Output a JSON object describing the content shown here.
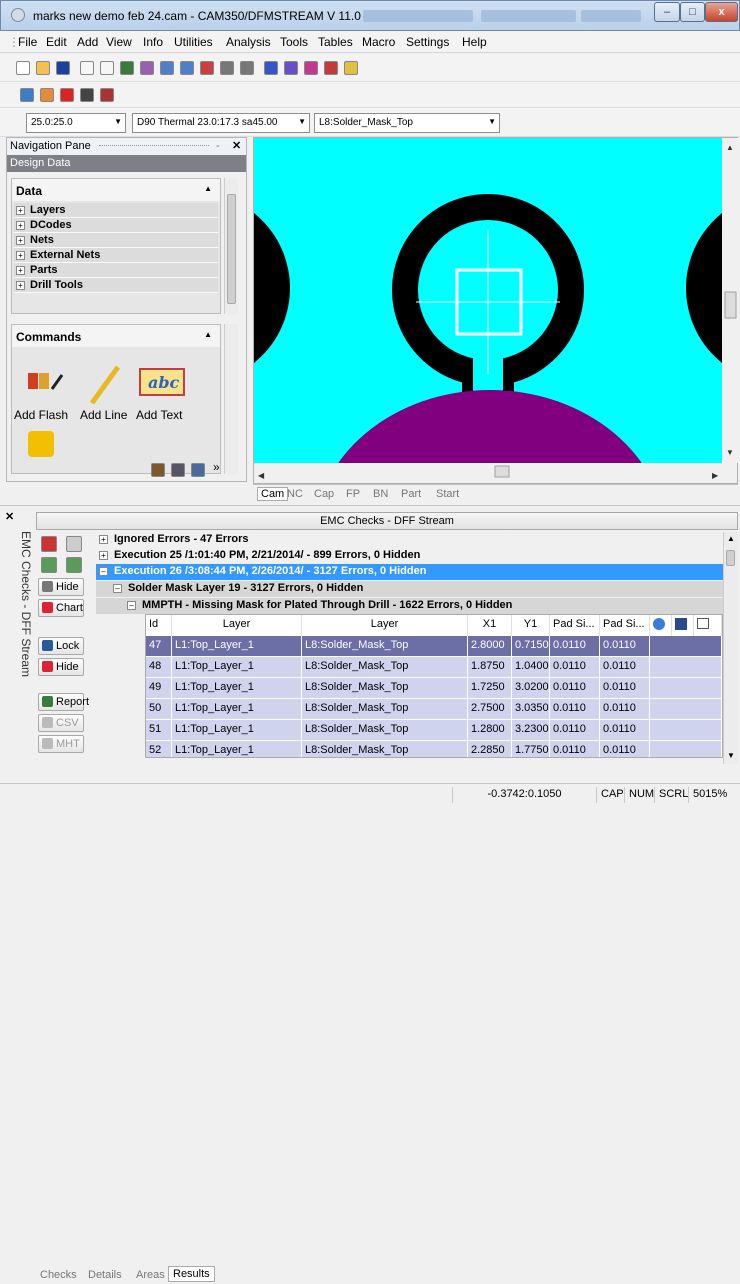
{
  "window": {
    "title": "marks new demo feb 24.cam - CAM350/DFMSTREAM V 11.0",
    "minimize_label": "–",
    "maximize_label": "□",
    "close_label": "x"
  },
  "menu": [
    "File",
    "Edit",
    "Add",
    "View",
    "Info",
    "Utilities",
    "Analysis",
    "Tools",
    "Tables",
    "Macro",
    "Settings",
    "Help"
  ],
  "toolbar": {
    "coord_combo": "25.0:25.0",
    "dcode_combo": "D90  Thermal 23.0:17.3 sa45.00",
    "layer_combo": "L8:Solder_Mask_Top"
  },
  "nav_pane": {
    "title": "Navigation Pane",
    "section_header": "Design Data",
    "data_title": "Data",
    "tree_items": [
      "Layers",
      "DCodes",
      "Nets",
      "External Nets",
      "Parts",
      "Drill Tools"
    ],
    "commands_title": "Commands",
    "commands": [
      "Add Flash",
      "Add Line",
      "Add Text"
    ]
  },
  "canvas": {
    "colors": {
      "background": "#00ffff",
      "pad": "#000000",
      "mask": "#800080",
      "cursor": "#ffffff"
    }
  },
  "view_tabs": [
    "Cam",
    "NC",
    "Cap",
    "FP",
    "BN",
    "Part",
    "Start"
  ],
  "emc": {
    "title": "EMC Checks - DFF Stream",
    "side_label": "EMC Checks - DFF Stream",
    "buttons": {
      "hide1": "Hide",
      "chart": "Chart",
      "lock": "Lock",
      "hide2": "Hide",
      "report": "Report",
      "csv": "CSV",
      "mht": "MHT"
    },
    "tree": [
      {
        "text": "Ignored Errors - 47 Errors",
        "sign": "+"
      },
      {
        "text": "Execution 25 /1:01:40 PM, 2/21/2014/ - 899 Errors, 0 Hidden",
        "sign": "+"
      },
      {
        "text": "Execution 26 /3:08:44 PM, 2/26/2014/ - 3127 Errors, 0 Hidden",
        "sign": "–"
      },
      {
        "text": "Solder Mask Layer 19 - 3127 Errors, 0 Hidden",
        "sign": "–"
      },
      {
        "text": "MMPTH - Missing Mask for Plated Through Drill - 1622 Errors, 0 Hidden",
        "sign": "–"
      }
    ],
    "columns": [
      "Id",
      "Layer",
      "Layer",
      "X1",
      "Y1",
      "Pad Si...",
      "Pad Si..."
    ],
    "rows": [
      [
        "47",
        "L1:Top_Layer_1",
        "L8:Solder_Mask_Top",
        "2.8000",
        "0.7150",
        "0.0110",
        "0.0110"
      ],
      [
        "48",
        "L1:Top_Layer_1",
        "L8:Solder_Mask_Top",
        "1.8750",
        "1.0400",
        "0.0110",
        "0.0110"
      ],
      [
        "49",
        "L1:Top_Layer_1",
        "L8:Solder_Mask_Top",
        "1.7250",
        "3.0200",
        "0.0110",
        "0.0110"
      ],
      [
        "50",
        "L1:Top_Layer_1",
        "L8:Solder_Mask_Top",
        "2.7500",
        "3.0350",
        "0.0110",
        "0.0110"
      ],
      [
        "51",
        "L1:Top_Layer_1",
        "L8:Solder_Mask_Top",
        "1.2800",
        "3.2300",
        "0.0110",
        "0.0110"
      ],
      [
        "52",
        "L1:Top_Layer_1",
        "L8:Solder_Mask_Top",
        "2.2850",
        "1.7750",
        "0.0110",
        "0.0110"
      ]
    ],
    "bottom_tabs": [
      "Checks",
      "Details",
      "Areas",
      "Results"
    ]
  },
  "status": {
    "coords": "-0.3742:0.1050",
    "cap": "CAP",
    "num": "NUM",
    "scrl": "SCRL",
    "zoom": "5015%"
  }
}
